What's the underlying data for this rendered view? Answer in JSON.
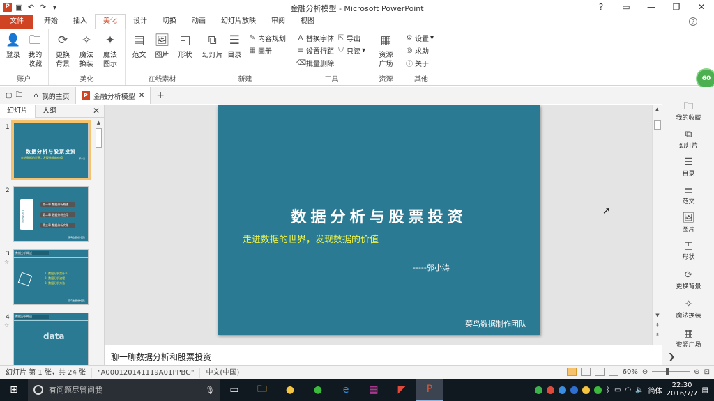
{
  "window": {
    "title": "金融分析模型 - Microsoft PowerPoint",
    "qat_icons": [
      "powerpoint-app-icon",
      "save-icon",
      "undo-icon",
      "redo-icon",
      "customize-icon"
    ],
    "controls": [
      "?",
      "▭",
      "—",
      "❐",
      "✕"
    ]
  },
  "tabs": [
    "文件",
    "开始",
    "插入",
    "美化",
    "设计",
    "切换",
    "动画",
    "幻灯片放映",
    "审阅",
    "视图"
  ],
  "active_tab": "美化",
  "ribbon": {
    "account": {
      "label": "账户",
      "buttons": [
        "登录",
        "我的\n收藏"
      ]
    },
    "beautify": {
      "label": "美化",
      "buttons": [
        "更换\n背景",
        "魔法\n换装",
        "魔法\n图示"
      ]
    },
    "online": {
      "label": "在线素材",
      "buttons": [
        "范文",
        "图片",
        "形状"
      ]
    },
    "new": {
      "label": "新建",
      "buttons": [
        "幻灯片",
        "目录"
      ],
      "small": [
        "内容规划",
        "画册"
      ]
    },
    "tools": {
      "label": "工具",
      "small": [
        "替换字体",
        "设置行距",
        "批量删除",
        "导出",
        "只读"
      ]
    },
    "resources": {
      "label": "资源",
      "buttons": [
        "资源\n广场"
      ]
    },
    "other": {
      "label": "其他",
      "small": [
        "设置",
        "求助",
        "关于"
      ]
    },
    "badge": "60"
  },
  "doc_tabs": {
    "home": "我的主页",
    "file": "金融分析模型"
  },
  "left_pane": {
    "tabs": [
      "幻灯片",
      "大纲"
    ],
    "close": "✕",
    "slide_numbers": [
      "1",
      "2",
      "3",
      "4"
    ],
    "thumb1": {
      "title": "数据分析与股票投资",
      "sub": "走进数据的世界，发现数据的价值",
      "author": "----郭小涛"
    },
    "thumb2": {
      "side": "Contents",
      "items": [
        "第一章 数据分析概述",
        "第二章 数据分析应用",
        "第三章 数据分析实践"
      ]
    },
    "thumb3": {
      "head": "数据分析概述",
      "items": [
        "1. 数据分析是什么",
        "2. 数据分析流程",
        "3. 数据分析方法"
      ]
    },
    "thumb4": {
      "head": "数据分析概述",
      "word": "data"
    },
    "footer": "菜鸟数据制作团队"
  },
  "slide": {
    "title": "数据分析与股票投资",
    "subtitle": "走进数据的世界，发现数据的价值",
    "author": "-----郭小涛",
    "team": "菜鸟数据制作团队"
  },
  "notes": "聊一聊数据分析和股票投资",
  "right_pane": [
    "我的收藏",
    "幻灯片",
    "目录",
    "范文",
    "图片",
    "形状",
    "更换背景",
    "魔法换装",
    "资源广场"
  ],
  "status": {
    "slide_info": "幻灯片 第 1 张，共 24 张",
    "theme": "\"A000120141119A01PPBG\"",
    "language": "中文(中国)",
    "zoom": "60%",
    "zoom_level": 0.6
  },
  "taskbar": {
    "search_placeholder": "有问题尽管问我",
    "tray_lang": "简体",
    "time": "22:30",
    "date": "2016/7/7"
  }
}
